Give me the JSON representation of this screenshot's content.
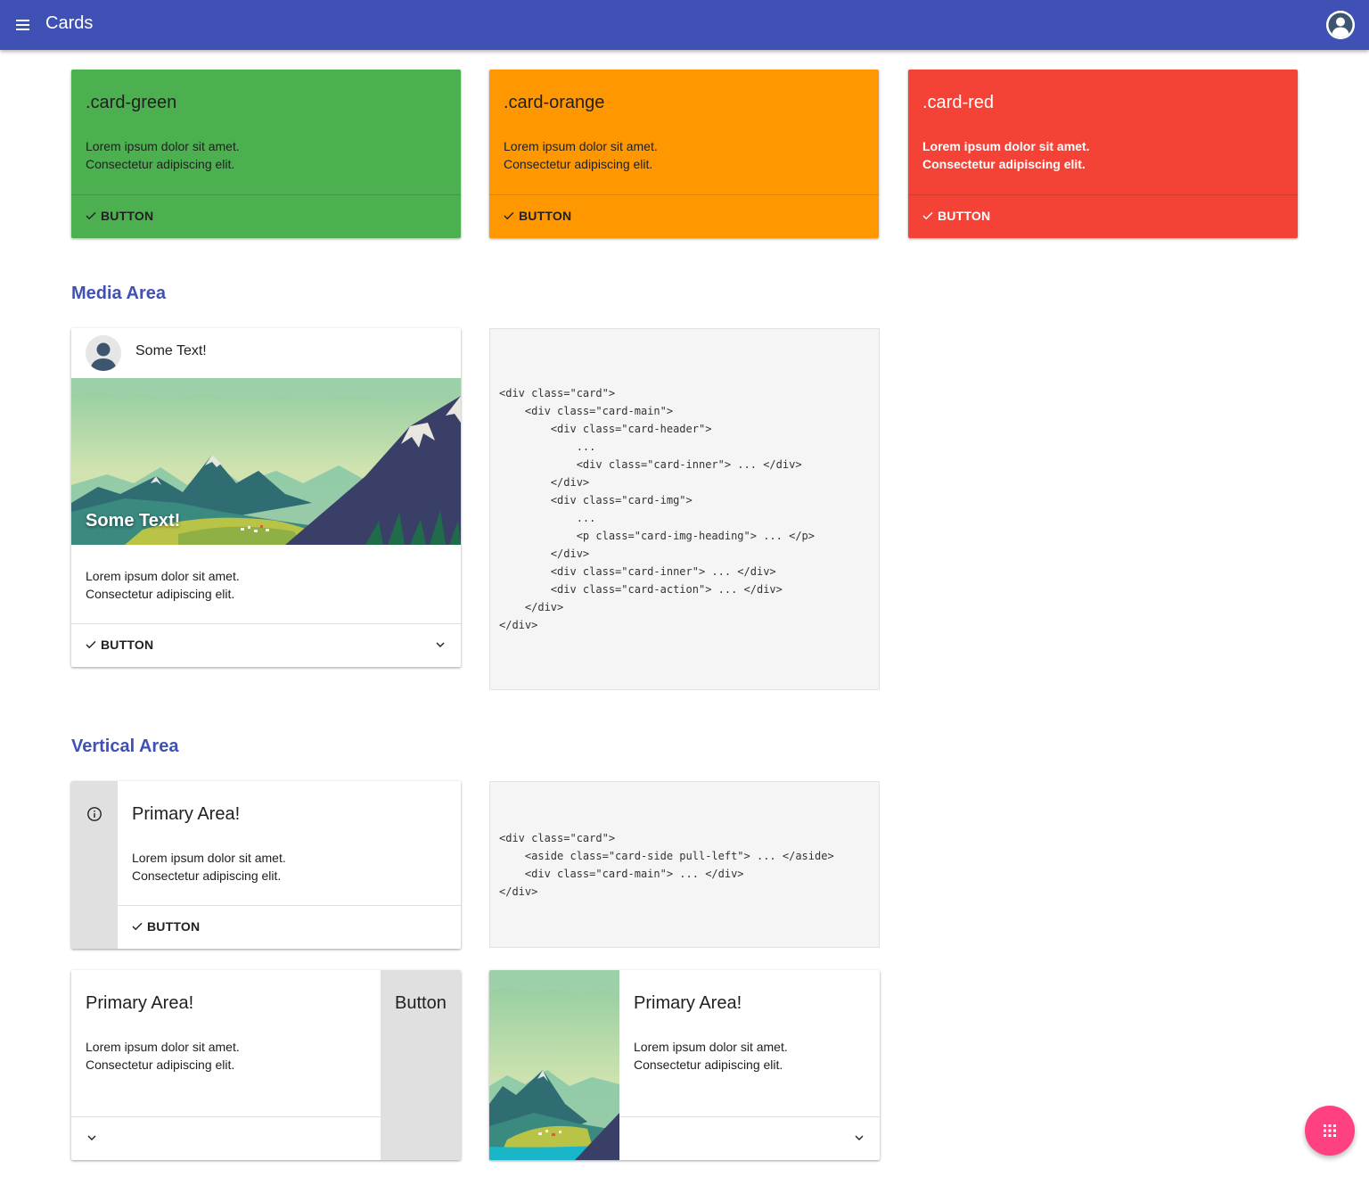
{
  "appbar": {
    "title": "Cards",
    "menu_icon": "menu-icon",
    "account_icon": "account-circle-icon",
    "color": "#3f51b5"
  },
  "color_cards": [
    {
      "title": ".card-green",
      "line1": "Lorem ipsum dolor sit amet.",
      "line2": "Consectetur adipiscing elit.",
      "button": "BUTTON",
      "color": "#4caf50"
    },
    {
      "title": ".card-orange",
      "line1": "Lorem ipsum dolor sit amet.",
      "line2": "Consectetur adipiscing elit.",
      "button": "BUTTON",
      "color": "#ff9800"
    },
    {
      "title": ".card-red",
      "line1": "Lorem ipsum dolor sit amet.",
      "line2": "Consectetur adipiscing elit.",
      "button": "BUTTON",
      "color": "#f44336"
    }
  ],
  "media_area": {
    "heading": "Media Area",
    "card": {
      "header_text": "Some Text!",
      "img_heading": "Some Text!",
      "line1": "Lorem ipsum dolor sit amet.",
      "line2": "Consectetur adipiscing elit.",
      "button": "BUTTON"
    },
    "code": "<div class=\"card\">\n    <div class=\"card-main\">\n        <div class=\"card-header\">\n            ...\n            <div class=\"card-inner\"> ... </div>\n        </div>\n        <div class=\"card-img\">\n            ...\n            <p class=\"card-img-heading\"> ... </p>\n        </div>\n        <div class=\"card-inner\"> ... </div>\n        <div class=\"card-action\"> ... </div>\n    </div>\n</div>"
  },
  "vertical_area": {
    "heading": "Vertical Area",
    "side_card": {
      "title": "Primary Area!",
      "line1": "Lorem ipsum dolor sit amet.",
      "line2": "Consectetur adipiscing elit.",
      "button": "BUTTON",
      "side_icon": "info-icon"
    },
    "code": "<div class=\"card\">\n    <aside class=\"card-side pull-left\"> ... </aside>\n    <div class=\"card-main\"> ... </div>\n</div>",
    "right_side_card": {
      "title": "Primary Area!",
      "line1": "Lorem ipsum dolor sit amet.",
      "line2": "Consectetur adipiscing elit.",
      "side_button": "Button"
    },
    "image_side_card": {
      "title": "Primary Area!",
      "line1": "Lorem ipsum dolor sit amet.",
      "line2": "Consectetur adipiscing elit."
    }
  },
  "fab": {
    "icon": "apps-icon",
    "color": "#ff4081"
  }
}
